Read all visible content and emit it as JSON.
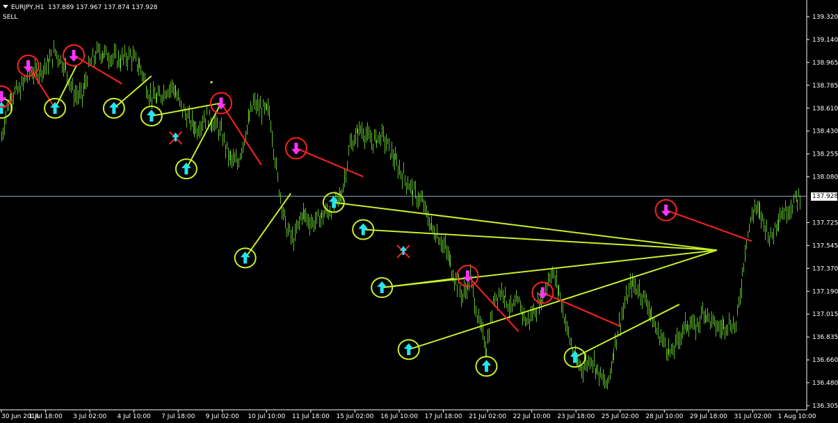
{
  "header": {
    "symbol_timeframe": "EURJPY,H1",
    "ohlc": "137.889 137.967 137.874 137.928",
    "signal": "SELL"
  },
  "current_price": "137.928",
  "colors": {
    "background": "#000000",
    "bars": "#5fbf2a",
    "axis": "#ffffff",
    "current_price_line": "#8fa3b8",
    "buy_arrow": "#22e5f0",
    "sell_arrow": "#ff33ff",
    "buy_circle": "#c7f02a",
    "sell_circle": "#ff2222",
    "buy_line": "#c7f02a",
    "sell_line": "#ff2222",
    "cross": "#ff2222"
  },
  "chart_data": {
    "type": "candlestick",
    "symbol": "EURJPY",
    "timeframe": "H1",
    "y_ticks": [
      "139.320",
      "139.140",
      "138.965",
      "138.785",
      "138.610",
      "138.430",
      "138.255",
      "138.080",
      "137.928",
      "137.725",
      "137.545",
      "137.370",
      "137.190",
      "137.015",
      "136.835",
      "136.660",
      "136.480",
      "136.305"
    ],
    "x_ticks": [
      "30 Jun 2014",
      "1 Jul 18:00",
      "3 Jul 02:00",
      "4 Jul 10:00",
      "7 Jul 18:00",
      "9 Jul 02:00",
      "10 Jul 10:00",
      "11 Jul 18:00",
      "15 Jul 02:00",
      "16 Jul 10:00",
      "17 Jul 18:00",
      "21 Jul 02:00",
      "22 Jul 10:00",
      "23 Jul 18:00",
      "25 Jul 02:00",
      "28 Jul 10:00",
      "29 Jul 18:00",
      "31 Jul 02:00",
      "1 Aug 10:00"
    ],
    "price_path": [
      [
        138.38,
        0
      ],
      [
        138.62,
        4
      ],
      [
        138.72,
        8
      ],
      [
        138.75,
        14
      ],
      [
        138.9,
        20
      ],
      [
        138.88,
        26
      ],
      [
        138.95,
        34
      ],
      [
        139.05,
        40
      ],
      [
        138.92,
        48
      ],
      [
        138.72,
        54
      ],
      [
        138.7,
        60
      ],
      [
        138.95,
        66
      ],
      [
        139.05,
        72
      ],
      [
        139.02,
        80
      ],
      [
        138.98,
        88
      ],
      [
        139.02,
        96
      ],
      [
        138.92,
        104
      ],
      [
        138.72,
        110
      ],
      [
        138.68,
        116
      ],
      [
        138.75,
        122
      ],
      [
        138.78,
        128
      ],
      [
        138.62,
        134
      ],
      [
        138.52,
        140
      ],
      [
        138.45,
        146
      ],
      [
        138.55,
        152
      ],
      [
        138.5,
        158
      ],
      [
        138.42,
        164
      ],
      [
        138.22,
        170
      ],
      [
        138.18,
        176
      ],
      [
        138.42,
        182
      ],
      [
        138.65,
        188
      ],
      [
        138.6,
        194
      ],
      [
        138.58,
        200
      ],
      [
        138.05,
        206
      ],
      [
        137.7,
        212
      ],
      [
        137.58,
        218
      ],
      [
        137.8,
        224
      ],
      [
        137.72,
        232
      ],
      [
        137.78,
        240
      ],
      [
        137.85,
        248
      ],
      [
        137.95,
        254
      ],
      [
        138.32,
        260
      ],
      [
        138.45,
        268
      ],
      [
        138.35,
        276
      ],
      [
        138.4,
        284
      ],
      [
        138.28,
        290
      ],
      [
        138.15,
        296
      ],
      [
        138.05,
        302
      ],
      [
        137.95,
        308
      ],
      [
        137.88,
        314
      ],
      [
        137.7,
        320
      ],
      [
        137.62,
        326
      ],
      [
        137.5,
        332
      ],
      [
        137.3,
        338
      ],
      [
        137.15,
        344
      ],
      [
        137.3,
        350
      ],
      [
        136.95,
        356
      ],
      [
        136.75,
        362
      ],
      [
        137.15,
        368
      ],
      [
        137.2,
        374
      ],
      [
        137.05,
        380
      ],
      [
        137.1,
        386
      ],
      [
        136.95,
        392
      ],
      [
        137.05,
        398
      ],
      [
        137.15,
        404
      ],
      [
        137.35,
        410
      ],
      [
        137.2,
        416
      ],
      [
        136.9,
        422
      ],
      [
        136.65,
        428
      ],
      [
        136.6,
        434
      ],
      [
        136.68,
        440
      ],
      [
        136.55,
        446
      ],
      [
        136.45,
        452
      ],
      [
        136.8,
        458
      ],
      [
        137.05,
        464
      ],
      [
        137.25,
        470
      ],
      [
        137.2,
        476
      ],
      [
        137.1,
        482
      ],
      [
        136.9,
        488
      ],
      [
        136.8,
        494
      ],
      [
        136.7,
        500
      ],
      [
        136.85,
        506
      ],
      [
        136.95,
        512
      ],
      [
        136.9,
        518
      ],
      [
        137.05,
        524
      ],
      [
        136.95,
        530
      ],
      [
        136.9,
        536
      ],
      [
        136.95,
        542
      ],
      [
        136.92,
        548
      ],
      [
        137.25,
        552
      ],
      [
        137.6,
        556
      ],
      [
        137.85,
        562
      ],
      [
        137.75,
        568
      ],
      [
        137.6,
        574
      ],
      [
        137.78,
        580
      ],
      [
        137.82,
        586
      ],
      [
        137.9,
        592
      ],
      [
        137.93,
        596
      ]
    ],
    "buy_signals": [
      [
        138.61,
        0
      ],
      [
        138.61,
        40
      ],
      [
        138.61,
        84
      ],
      [
        138.55,
        112
      ],
      [
        138.14,
        138
      ],
      [
        137.45,
        182
      ],
      [
        137.88,
        248
      ],
      [
        137.67,
        270
      ],
      [
        137.22,
        284
      ],
      [
        136.74,
        304
      ],
      [
        136.61,
        362
      ],
      [
        136.68,
        428
      ]
    ],
    "sell_signals": [
      [
        138.7,
        0
      ],
      [
        138.94,
        20
      ],
      [
        139.02,
        54
      ],
      [
        138.65,
        164
      ],
      [
        138.3,
        220
      ],
      [
        137.31,
        348
      ],
      [
        137.18,
        404
      ],
      [
        137.82,
        496
      ]
    ]
  }
}
